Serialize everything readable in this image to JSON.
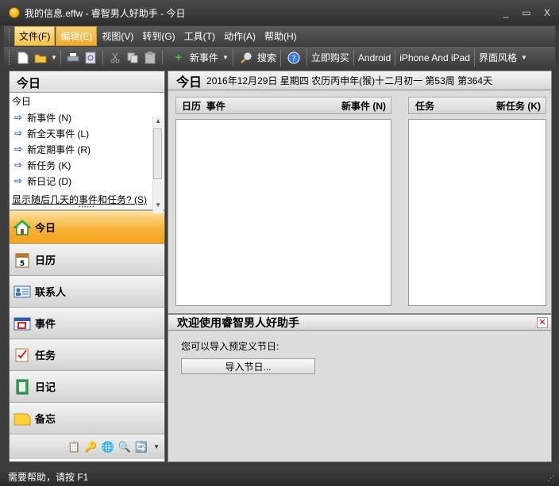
{
  "window": {
    "title": "我的信息.effw - 睿智男人好助手 - 今日",
    "controls": [
      "_",
      "▭",
      "X"
    ]
  },
  "menu": {
    "items": [
      "文件(F)",
      "编辑(E)",
      "视图(V)",
      "转到(G)",
      "工具(T)",
      "动作(A)",
      "帮助(H)"
    ]
  },
  "toolbar": {
    "new_event": "新事件",
    "search": "搜索",
    "buy_now": "立即购买",
    "android": "Android",
    "iphone_ipad": "iPhone And iPad",
    "skin": "界面风格"
  },
  "left": {
    "header": "今日",
    "box_title": "今日",
    "items": [
      "新事件 (N)",
      "新全天事件 (L)",
      "新定期事件 (R)",
      "新任务 (K)",
      "新日记 (D)"
    ],
    "show_days": "显示随后几天的事件和任务? (S)",
    "nav": [
      "今日",
      "日历",
      "联系人",
      "事件",
      "任务",
      "日记",
      "备忘"
    ]
  },
  "right": {
    "header_big": "今日",
    "header_date": "2016年12月29日 星期四 农历丙申年(猴)十二月初一 第53周 第364天",
    "col_date": "日历",
    "col_event": "事件",
    "new_event_link": "新事件 (N)",
    "col_task": "任务",
    "new_task_link": "新任务 (K)"
  },
  "welcome": {
    "title": "欢迎使用睿智男人好助手",
    "info": "您可以导入预定义节日:",
    "import_button": "导入节日..."
  },
  "status": {
    "text": "需要帮助，请按 F1"
  },
  "colors": {
    "accent_orange": "#f5a21a",
    "chrome_dark": "#3e3e3e",
    "panel_gray": "#dcdcdc"
  }
}
